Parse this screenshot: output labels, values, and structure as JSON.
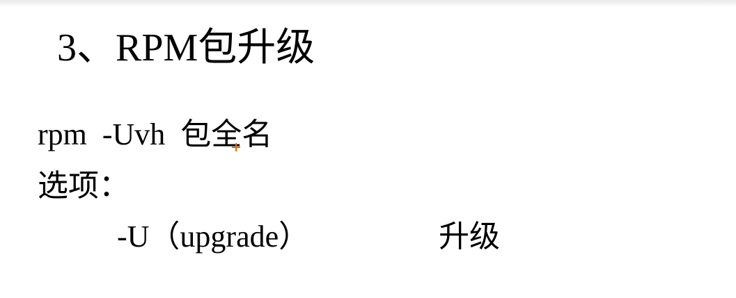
{
  "slide": {
    "title": "3、RPM包升级",
    "command": "rpm  -Uvh  包全名",
    "options_label": "选项：",
    "options": [
      {
        "flag": "-U（upgrade）",
        "description": "升级"
      }
    ]
  },
  "colors": {
    "text": "#000000",
    "background": "#ffffff",
    "cursor": "#e07000"
  },
  "icons": {
    "cursor": "crosshair-cursor-icon"
  }
}
